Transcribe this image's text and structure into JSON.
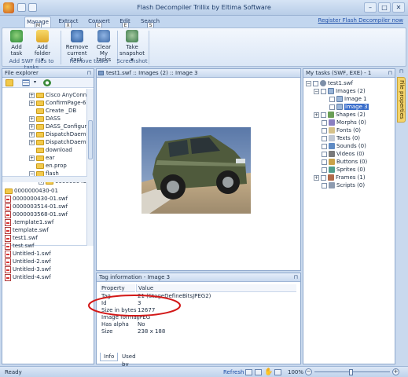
{
  "window": {
    "title": "Flash Decompiler Trillix by Eltima Software"
  },
  "ribbon": {
    "tabs": [
      {
        "label": "Manage",
        "keytip": "M"
      },
      {
        "label": "Extract",
        "keytip": "X"
      },
      {
        "label": "Convert",
        "keytip": "C"
      },
      {
        "label": "Edit",
        "keytip": "E"
      },
      {
        "label": "Search",
        "keytip": "S"
      }
    ],
    "register_link": "Register Flash Decompiler now",
    "buttons": {
      "add_task": "Add task",
      "add_folder": "Add folder",
      "remove_current_task_1": "Remove",
      "remove_current_task_2": "current task",
      "clear_my_tasks_1": "Clear",
      "clear_my_tasks_2": "My tasks",
      "take_snapshot_1": "Take",
      "take_snapshot_2": "snapshot"
    },
    "groups": {
      "add": "Add SWF files to tasks",
      "remove": "Remove tasks",
      "screenshot": "Screenshot"
    }
  },
  "file_explorer": {
    "title": "File explorer",
    "tree": [
      "Cisco AnyConnect",
      "ConfirmPage-6",
      "Create _DB",
      "DASS",
      "DASS_Configurati",
      "DispatchDaemon_",
      "DispatchDaemon_",
      "download",
      "ear",
      "en.prop",
      "flash",
      "0000000430-0"
    ],
    "files": [
      "0000000430-01",
      "0000000430-01.swf",
      "0000003514-01.swf",
      "0000003568-01.swf",
      ".template1.swf",
      "template.swf",
      "test1.swf",
      "test.swf",
      "Untitled-1.swf",
      "Untitled-2.swf",
      "Untitled-3.swf",
      "Untitled-4.swf"
    ]
  },
  "viewer": {
    "breadcrumb": "test1.swf :: Images (2) :: Image 3"
  },
  "tag_info": {
    "title": "Tag information - Image 3",
    "col_property": "Property",
    "col_value": "Value",
    "rows": [
      {
        "property": "Tag",
        "value": "21 (StageDefineBitsJPEG2)"
      },
      {
        "property": "Id",
        "value": "3"
      },
      {
        "property": "Size in bytes",
        "value": "12677"
      },
      {
        "property": "Image format",
        "value": "JPEG"
      },
      {
        "property": "Has alpha",
        "value": "No"
      },
      {
        "property": "Size",
        "value": "238 x 188"
      }
    ],
    "tabs": [
      "Info",
      "Used by"
    ]
  },
  "my_tasks": {
    "title": "My tasks (SWF, EXE) - 1",
    "root": "test1.swf",
    "images_label": "Images (2)",
    "image_children": [
      "Image 1",
      "Image 3"
    ],
    "categories": [
      "Shapes (2)",
      "Morphs (0)",
      "Fonts (0)",
      "Texts (0)",
      "Sounds (0)",
      "Videos (0)",
      "Buttons (0)",
      "Sprites (0)",
      "Frames (1)",
      "Scripts (0)"
    ],
    "side_tab": "File properties"
  },
  "status": {
    "ready": "Ready",
    "refresh": "Refresh",
    "zoom": "100%"
  }
}
